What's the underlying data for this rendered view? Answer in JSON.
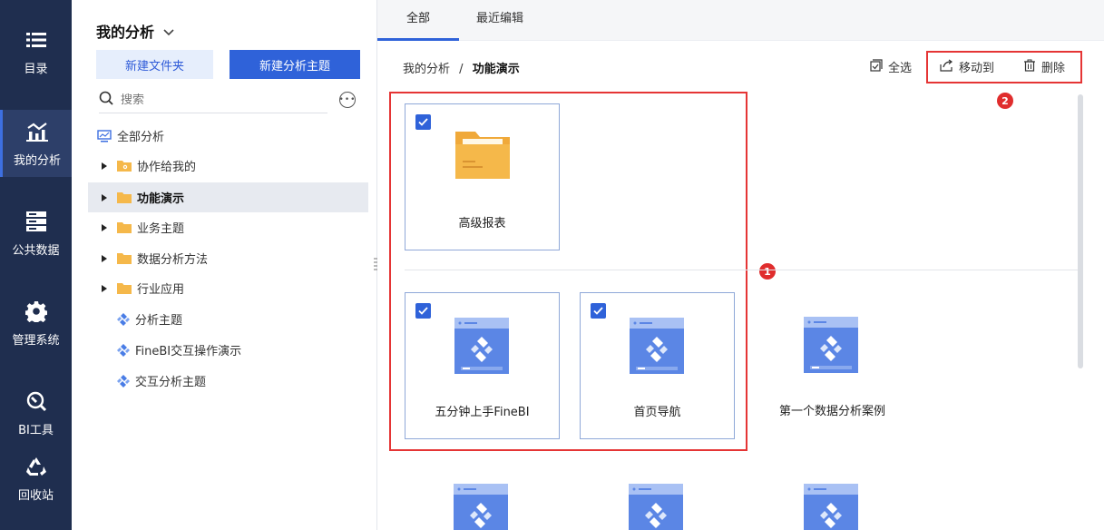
{
  "rail": {
    "items": [
      {
        "label": "目录",
        "icon": "list-icon"
      },
      {
        "label": "我的分析",
        "icon": "analysis-chart-icon"
      },
      {
        "label": "公共数据",
        "icon": "database-icon"
      },
      {
        "label": "管理系统",
        "icon": "gear-icon"
      },
      {
        "label": "BI工具",
        "icon": "tools-icon"
      },
      {
        "label": "回收站",
        "icon": "recycle-icon"
      }
    ]
  },
  "tree": {
    "title": "我的分析",
    "new_folder_label": "新建文件夹",
    "new_topic_label": "新建分析主题",
    "search_placeholder": "搜索",
    "items": [
      {
        "label": "全部分析",
        "icon": "monitor-icon"
      },
      {
        "label": "协作给我的",
        "icon": "shared-folder-icon"
      },
      {
        "label": "功能演示",
        "icon": "folder-icon"
      },
      {
        "label": "业务主题",
        "icon": "folder-icon"
      },
      {
        "label": "数据分析方法",
        "icon": "folder-icon"
      },
      {
        "label": "行业应用",
        "icon": "folder-icon"
      },
      {
        "label": "分析主题",
        "icon": "topic-icon"
      },
      {
        "label": "FineBI交互操作演示",
        "icon": "topic-icon"
      },
      {
        "label": "交互分析主题",
        "icon": "topic-icon"
      }
    ]
  },
  "main": {
    "tabs": [
      {
        "label": "全部"
      },
      {
        "label": "最近编辑"
      }
    ],
    "breadcrumb": {
      "root": "我的分析",
      "separator": "/",
      "current": "功能演示"
    },
    "actions": {
      "select_all": "全选",
      "move_to": "移动到",
      "delete": "删除"
    },
    "annotations": {
      "one": "1",
      "two": "2"
    },
    "cards": [
      {
        "name": "高级报表",
        "type": "folder",
        "checked": true
      },
      {
        "name": "五分钟上手FineBI",
        "type": "topic",
        "checked": true
      },
      {
        "name": "首页导航",
        "type": "topic",
        "checked": true
      },
      {
        "name": "第一个数据分析案例",
        "type": "topic",
        "checked": false
      }
    ]
  },
  "colors": {
    "rail_bg": "#1f2e4f",
    "accent": "#2f62d9",
    "highlight": "#e53535",
    "folder": "#f5b84a"
  }
}
